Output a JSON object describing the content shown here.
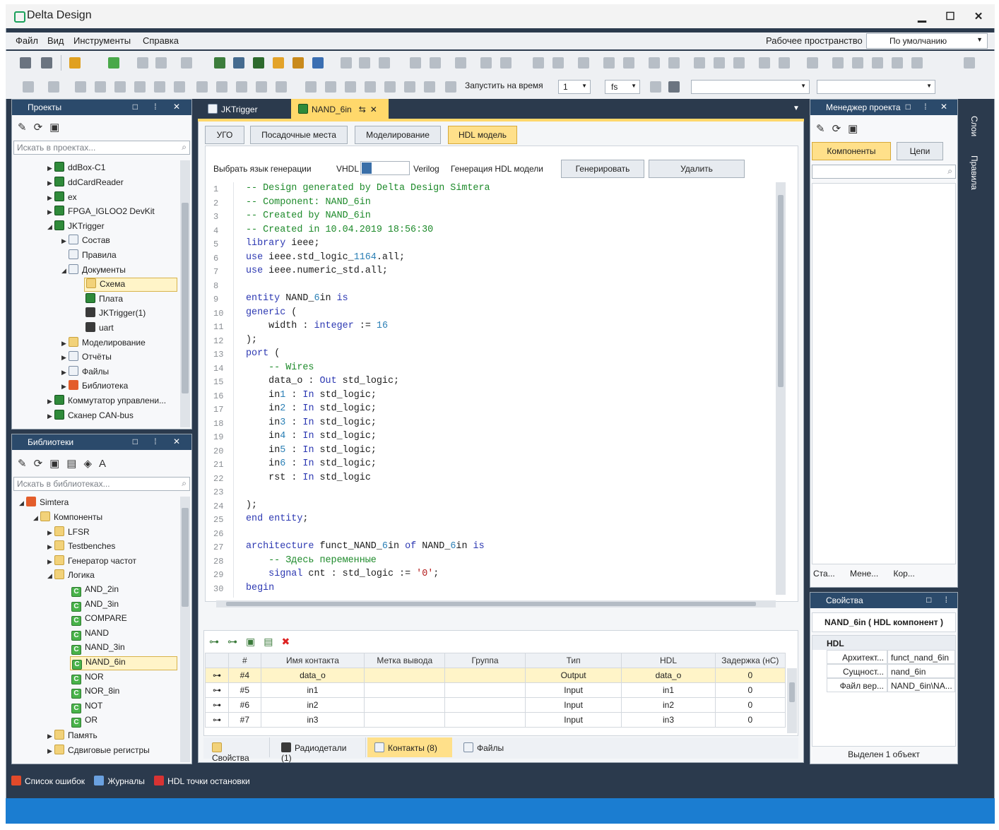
{
  "app": {
    "title": "Delta Design",
    "minimize": "▁",
    "maximize": "☐",
    "close": "✕"
  },
  "menu": {
    "items": [
      "Файл",
      "Вид",
      "Инструменты",
      "Справка"
    ],
    "workspace_label": "Рабочее пространство",
    "workspace_value": "По умолчанию"
  },
  "toolbar2": {
    "run_label": "Запустить на время",
    "run_value": "1",
    "unit_value": "fs"
  },
  "projects": {
    "title": "Проекты",
    "search_placeholder": "Искать в проектах...",
    "items": [
      "ddBox-C1",
      "ddCardReader",
      "ex",
      "FPGA_IGLOO2 DevKit",
      "JKTrigger",
      "Состав",
      "Правила",
      "Документы",
      "Схема",
      "Плата",
      "JKTrigger(1)",
      "uart",
      "Моделирование",
      "Отчёты",
      "Файлы",
      "Библиотека",
      "Коммутатор управлени...",
      "Сканер CAN-bus"
    ]
  },
  "libraries": {
    "title": "Библиотеки",
    "search_placeholder": "Искать в библиотеках...",
    "items": [
      "Simtera",
      "Компоненты",
      "LFSR",
      "Testbenches",
      "Генератор частот",
      "Логика",
      "AND_2in",
      "AND_3in",
      "COMPARE",
      "NAND",
      "NAND_3in",
      "NAND_6in",
      "NOR",
      "NOR_8in",
      "NOT",
      "OR",
      "Память",
      "Сдвиговые регистры"
    ]
  },
  "doc_tabs": [
    "JKTrigger",
    "NAND_6in"
  ],
  "view_tabs": [
    "УГО",
    "Посадочные места",
    "Моделирование",
    "HDL модель"
  ],
  "hdl": {
    "lang_label": "Выбрать язык генерации",
    "vhdl": "VHDL",
    "verilog": "Verilog",
    "gen_label": "Генерация HDL модели",
    "generate": "Генерировать",
    "delete": "Удалить"
  },
  "code_lines": [
    "-- Design generated by Delta Design Simtera",
    "-- Component: NAND_6in",
    "-- Created by NAND_6in",
    "-- Created in 10.04.2019 18:56:30",
    "library ieee;",
    "use ieee.std_logic_1164.all;",
    "use ieee.numeric_std.all;",
    "",
    "entity NAND_6in is",
    "generic (",
    "    width : integer := 16",
    ");",
    "port (",
    "    -- Wires",
    "    data_o : Out std_logic;",
    "    in1 : In std_logic;",
    "    in2 : In std_logic;",
    "    in3 : In std_logic;",
    "    in4 : In std_logic;",
    "    in5 : In std_logic;",
    "    in6 : In std_logic;",
    "    rst : In std_logic",
    "",
    ");",
    "end entity;",
    "",
    "architecture funct_NAND_6in of NAND_6in is",
    "    -- Здесь переменные",
    "    signal cnt : std_logic := '0';",
    "begin"
  ],
  "pins": {
    "headers": [
      "#",
      "Имя контакта",
      "Метка вывода",
      "Группа",
      "Тип",
      "HDL",
      "Задержка (нС)"
    ],
    "rows": [
      [
        "#4",
        "data_o",
        "",
        "",
        "Output",
        "data_o",
        "0"
      ],
      [
        "#5",
        "in1",
        "",
        "",
        "Input",
        "in1",
        "0"
      ],
      [
        "#6",
        "in2",
        "",
        "",
        "Input",
        "in2",
        "0"
      ],
      [
        "#7",
        "in3",
        "",
        "",
        "Input",
        "in3",
        "0"
      ]
    ]
  },
  "bottom_tabs": [
    "Свойства",
    "Радиодетали (1)",
    "Контакты (8)",
    "Файлы"
  ],
  "project_manager": {
    "title": "Менеджер проекта",
    "tab_components": "Компоненты",
    "tab_nets": "Цепи",
    "bottom_tabs": [
      "Ста...",
      "Мене...",
      "Кор..."
    ]
  },
  "side_tabs": [
    "Слои",
    "Правила"
  ],
  "properties": {
    "title": "Свойства",
    "heading": "NAND_6in ( HDL компонент )",
    "group": "HDL",
    "rows": [
      [
        "Архитект...",
        "funct_nand_6in"
      ],
      [
        "Сущност...",
        "nand_6in"
      ],
      [
        "Файл вер...",
        "NAND_6in\\NA..."
      ]
    ],
    "status": "Выделен 1 объект"
  },
  "dock_bottom": [
    "Список ошибок",
    "Журналы",
    "HDL точки остановки"
  ]
}
